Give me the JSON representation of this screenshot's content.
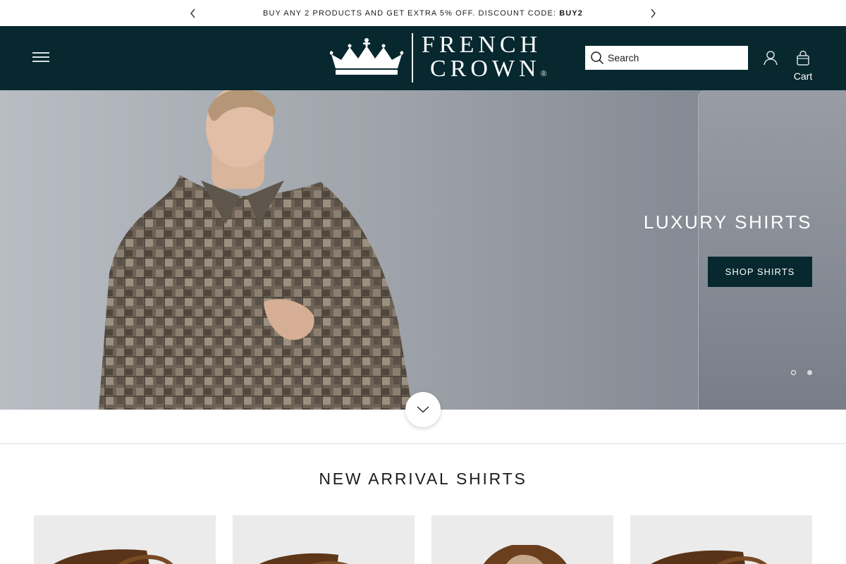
{
  "announcement": {
    "text": "BUY ANY 2 PRODUCTS AND GET EXTRA 5% OFF. DISCOUNT CODE: ",
    "code": "BUY2"
  },
  "header": {
    "brand_line1": "FRENCH",
    "brand_line2": "CROWN",
    "brand_mark": "®",
    "search_placeholder": "Search",
    "cart_label": "Cart"
  },
  "hero": {
    "headline": "LUXURY SHIRTS",
    "cta_label": "SHOP SHIRTS",
    "slide_count": 2,
    "active_slide": 1
  },
  "section": {
    "title": "NEW ARRIVAL SHIRTS"
  },
  "products": [
    {
      "icon": "shirt-collar-image"
    },
    {
      "icon": "shirt-collar-image"
    },
    {
      "icon": "shirt-collar-image"
    },
    {
      "icon": "shirt-collar-image"
    }
  ],
  "colors": {
    "brand_dark": "#06282e",
    "accent_white": "#ffffff"
  }
}
